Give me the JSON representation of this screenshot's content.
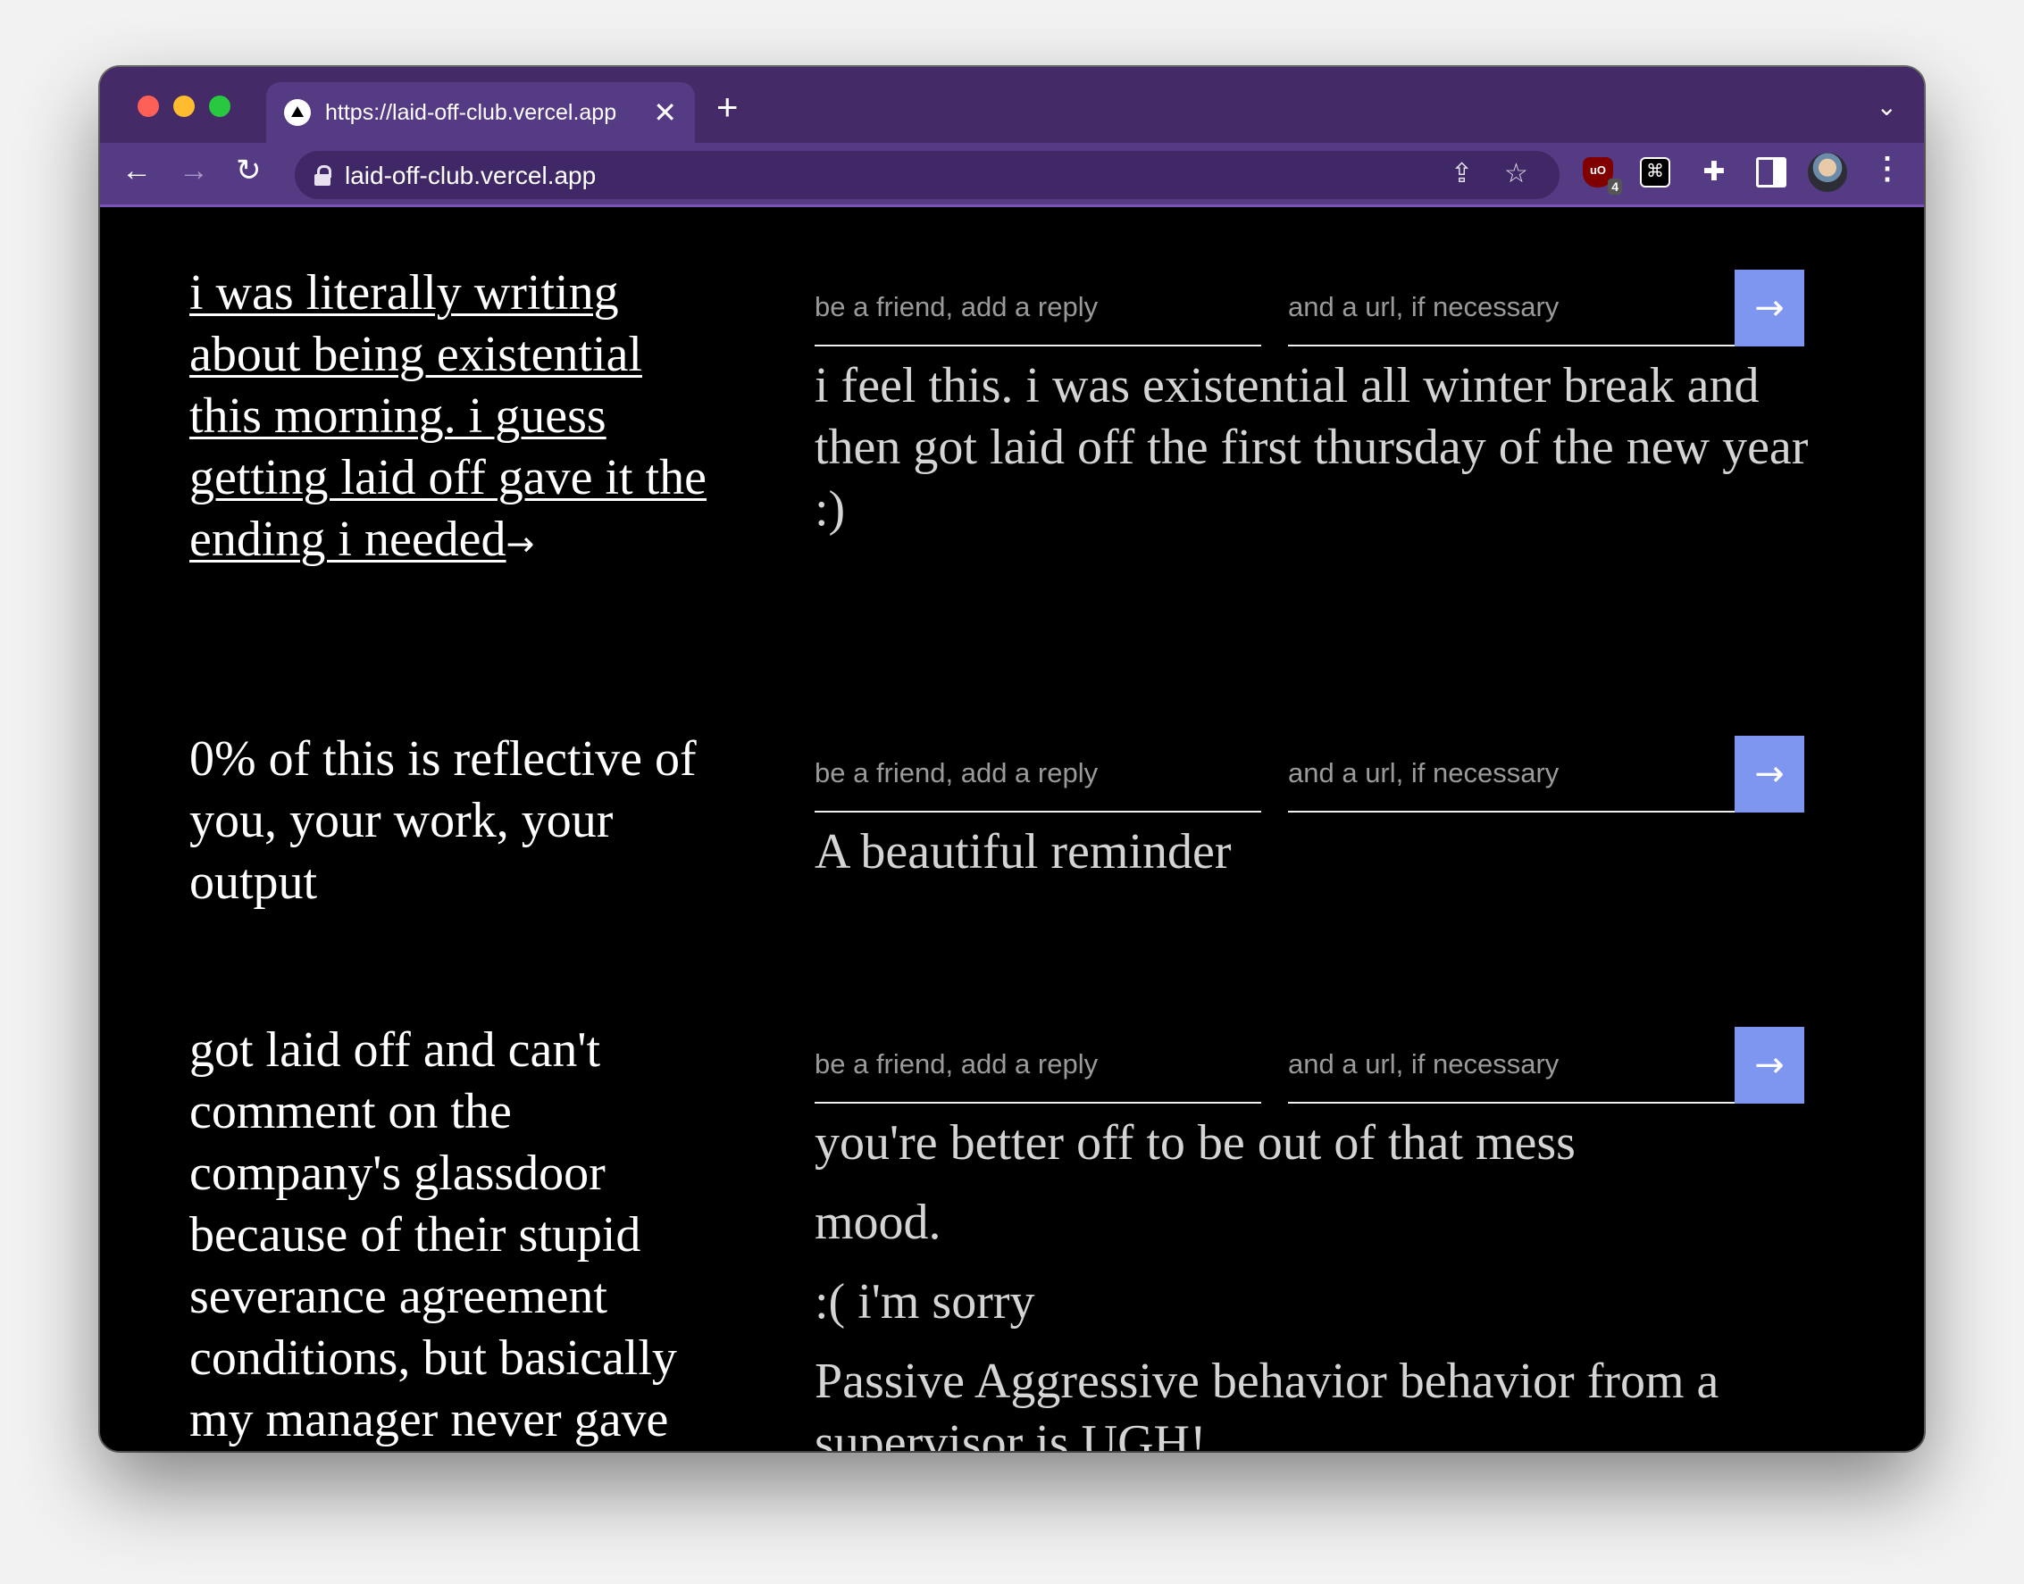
{
  "browser": {
    "tab_title": "https://laid-off-club.vercel.app",
    "tab_close": "✕",
    "new_tab": "+",
    "url": "laid-off-club.vercel.app",
    "extension_badge": "4"
  },
  "form": {
    "reply_placeholder": "be a friend, add a reply",
    "url_placeholder": "and a url, if necessary",
    "submit_label": "→"
  },
  "posts": [
    {
      "text": "i was literally writing about being existential this morning. i guess getting laid off gave it the ending i needed",
      "link_arrow": "→",
      "replies": [
        "i feel this. i was existential all winter break and then got laid off the first thursday of the new year :)"
      ]
    },
    {
      "text": "0% of this is reflective of you, your work, your output",
      "replies": [
        "A beautiful reminder"
      ]
    },
    {
      "text": "got laid off and can't comment on the company's glassdoor because of their stupid severance agreement conditions, but basically my manager never gave me any feedback and",
      "replies": [
        "you're better off to be out of that mess",
        "mood.",
        ":( i'm sorry",
        "Passive Aggressive behavior behavior from a supervisor is UGH!"
      ]
    }
  ]
}
